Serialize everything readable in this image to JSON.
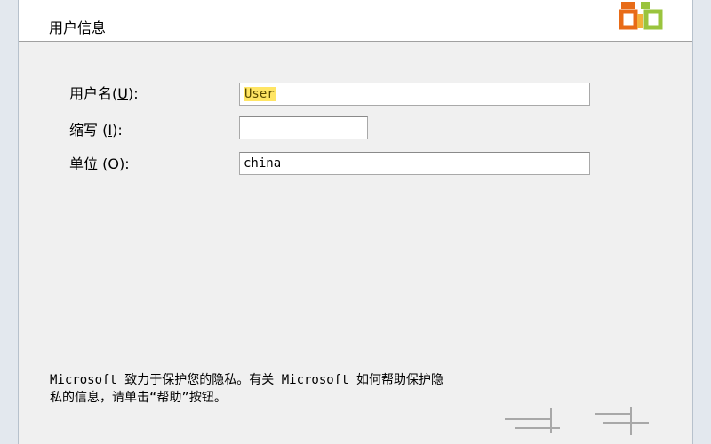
{
  "header": {
    "title": "用户信息",
    "logo_icon": "office-logo-icon",
    "logo_color": "#e86b17"
  },
  "form": {
    "fields": [
      {
        "label": "用户名",
        "mnemonic": "U",
        "colon": ":",
        "value": "User",
        "selected": true
      },
      {
        "label": "缩写",
        "mnemonic": "I",
        "colon": ":",
        "value": ""
      },
      {
        "label": "单位",
        "mnemonic": "O",
        "colon": ":",
        "value": "china"
      }
    ]
  },
  "privacy": {
    "line1": "Microsoft 致力于保护您的隐私。有关 Microsoft 如何帮助保护隐",
    "line2": "私的信息，请单击“帮助”按钮。"
  },
  "colors": {
    "selection": "#ffe564",
    "header_bg": "#ffffff",
    "content_bg": "#f0f0f0"
  }
}
